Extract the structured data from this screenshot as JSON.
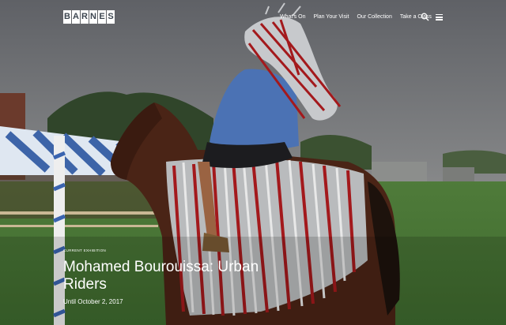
{
  "brand": {
    "logo_letters": [
      "B",
      "A",
      "R",
      "N",
      "E",
      "S"
    ]
  },
  "nav": {
    "items": [
      {
        "label": "What's On"
      },
      {
        "label": "Plan Your Visit"
      },
      {
        "label": "Our Collection"
      },
      {
        "label": "Take a Class"
      }
    ]
  },
  "icons": {
    "search": "search-icon",
    "menu": "hamburger-menu-icon"
  },
  "hero": {
    "kicker": "CURRENT EXHIBITION",
    "title": "Mohamed Bourouissa: Urban Riders",
    "dates": "Until October 2, 2017"
  }
}
